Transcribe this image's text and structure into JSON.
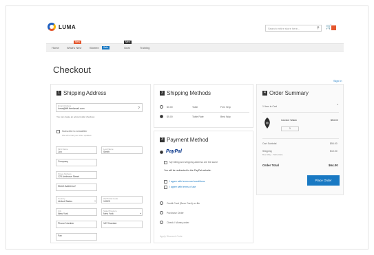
{
  "header": {
    "brand": "LUMA",
    "search_placeholder": "Search entire store here..."
  },
  "nav": {
    "items": [
      "Home",
      "What's New",
      "Women",
      "Men",
      "Gear",
      "Training"
    ],
    "tag_new": "New",
    "tag_sale": "Sale",
    "tag_men": "Men"
  },
  "page": {
    "title": "Checkout",
    "signin": "Sign In"
  },
  "shipping": {
    "step": "1",
    "title": "Shipping Address",
    "email_label": "Email Address",
    "email_value": "luma@ttff.freelsmail.com",
    "email_note": "You can create an account after checkout.",
    "subscribe": "Subscribe to newsletter",
    "subscribe_note": "We will email you order updates.",
    "first_label": "First Name",
    "first_value": "Jon",
    "last_label": "Last Name",
    "last_value": "Smith",
    "company": "Company",
    "street_label": "Street Address",
    "street_value": "123 Ambrose Street",
    "street2": "Street Address 2",
    "country_label": "Country",
    "country_value": "United States",
    "zip_label": "Zip/Postal Code",
    "zip_value": "10023",
    "city_label": "City",
    "city_value": "New York",
    "state_label": "State/Province",
    "state_value": "New York",
    "phone_label": "Phone Number",
    "vat_label": "VAT Number",
    "fax": "Fax"
  },
  "methods": {
    "step": "2",
    "title": "Shipping Methods",
    "rows": [
      {
        "price": "$0.00",
        "method": "Table",
        "carrier": "Free Ship"
      },
      {
        "price": "$5.00",
        "method": "Table Rate",
        "carrier": "Best Way"
      }
    ]
  },
  "payment": {
    "step": "3",
    "title": "Payment Method",
    "paypal": "PayPal",
    "same_address": "My billing and shipping address are the same",
    "redirect_note": "You will be redirected to the PayPal website.",
    "terms": "I agree with terms and conditions",
    "privacy": "I agree with terms of use",
    "option_cod": "Credit Card (Save Card) on file",
    "option_po": "Purchase Order",
    "option_check": "Check / Money order",
    "discount": "Apply Discount Code"
  },
  "summary": {
    "step": "4",
    "title": "Order Summary",
    "items_in_cart": "1 Item in Cart",
    "product_name": "Camber Watch",
    "product_price": "$54.00",
    "qty": "1",
    "subtotal_label": "Cart Subtotal",
    "subtotal_value": "$54.00",
    "shipping_label": "Shipping",
    "shipping_note": "Best Way - Table Rate",
    "shipping_value": "$10.00",
    "total_label": "Order Total",
    "total_value": "$64.00",
    "place_order": "Place Order"
  },
  "colors": {
    "accent": "#1979c3",
    "brand_orange": "#e4572e"
  }
}
